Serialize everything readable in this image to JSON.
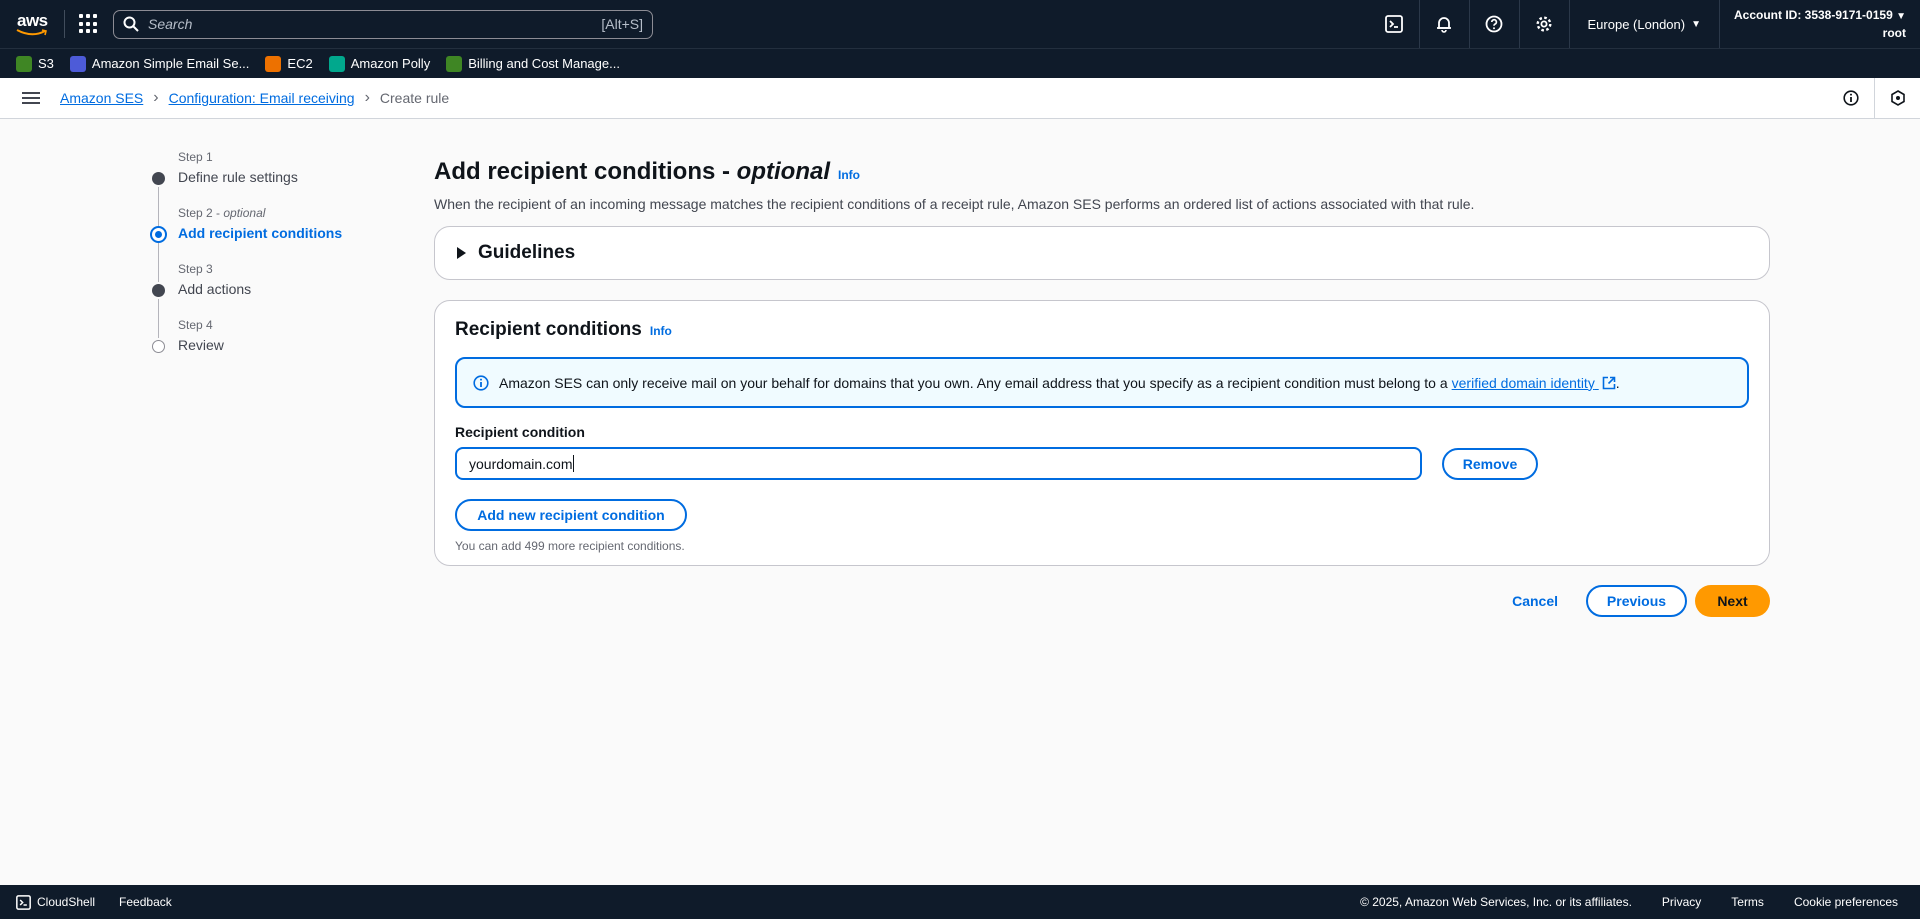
{
  "nav": {
    "logo": "aws",
    "search_placeholder": "Search",
    "search_shortcut": "[Alt+S]",
    "region": "Europe (London)",
    "account_id": "Account ID: 3538-9171-0159",
    "user": "root"
  },
  "favorites": [
    {
      "label": "S3",
      "color": "#3f8624"
    },
    {
      "label": "Amazon Simple Email Se...",
      "color": "#4d5bd8"
    },
    {
      "label": "EC2",
      "color": "#ed7100"
    },
    {
      "label": "Amazon Polly",
      "color": "#01a88d"
    },
    {
      "label": "Billing and Cost Manage...",
      "color": "#3f8624"
    }
  ],
  "breadcrumb": {
    "items": [
      "Amazon SES",
      "Configuration: Email receiving"
    ],
    "current": "Create rule"
  },
  "steps": [
    {
      "number": "Step 1",
      "name": "Define rule settings"
    },
    {
      "number": "Step 2",
      "optional": "optional",
      "name": "Add recipient conditions"
    },
    {
      "number": "Step 3",
      "name": "Add actions"
    },
    {
      "number": "Step 4",
      "name": "Review"
    }
  ],
  "main": {
    "title": "Add recipient conditions - ",
    "title_optional": "optional",
    "info": "Info",
    "description": "When the recipient of an incoming message matches the recipient conditions of a receipt rule, Amazon SES performs an ordered list of actions associated with that rule.",
    "guidelines": "Guidelines"
  },
  "recipient_conditions": {
    "title": "Recipient conditions",
    "info": "Info",
    "alert_text": "Amazon SES can only receive mail on your behalf for domains that you own. Any email address that you specify as a recipient condition must belong to a",
    "alert_link": "verified domain identity",
    "alert_end": ".",
    "label": "Recipient condition",
    "value": "yourdomain.com",
    "remove": "Remove",
    "add": "Add new recipient condition",
    "hint": "You can add 499 more recipient conditions."
  },
  "actions": {
    "cancel": "Cancel",
    "previous": "Previous",
    "next": "Next"
  },
  "footer": {
    "cloudshell": "CloudShell",
    "feedback": "Feedback",
    "copyright": "© 2025, Amazon Web Services, Inc. or its affiliates.",
    "privacy": "Privacy",
    "terms": "Terms",
    "cookies": "Cookie preferences"
  }
}
